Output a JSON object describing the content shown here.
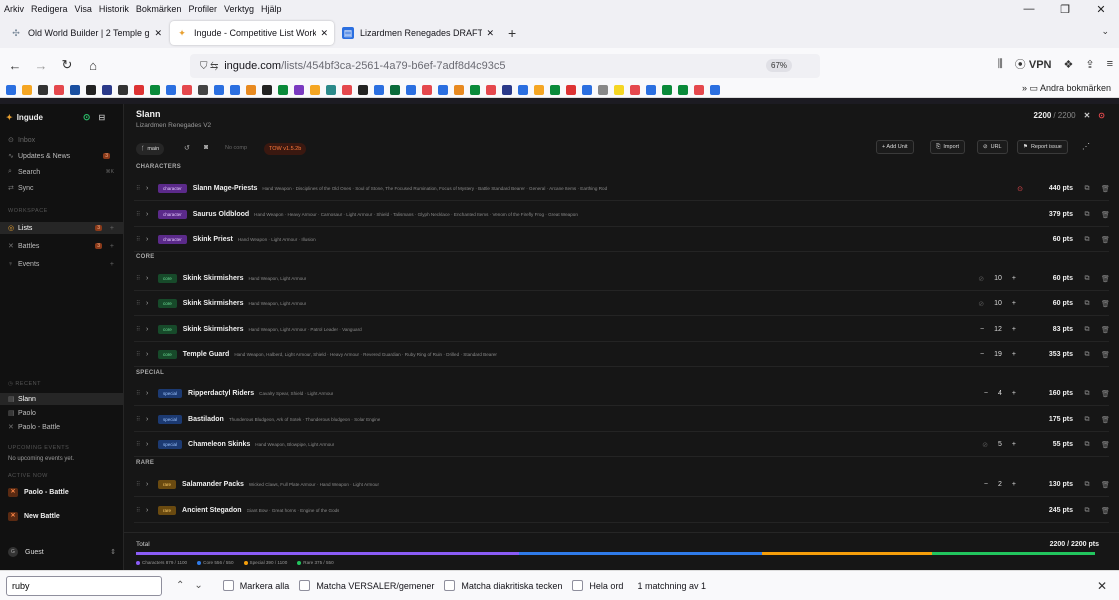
{
  "menu": [
    "Arkiv",
    "Redigera",
    "Visa",
    "Historik",
    "Bokmärken",
    "Profiler",
    "Verktyg",
    "Hjälp"
  ],
  "tabs": [
    {
      "title": "Old World Builder | 2 Temple gu",
      "icon": "puzzle-icon",
      "color": "#7a8a9a"
    },
    {
      "title": "Ingude - Competitive List Work",
      "icon": "bird-icon",
      "color": "#e8a030"
    },
    {
      "title": "Lizardmen Renegades DRAFT V",
      "icon": "doc-icon",
      "color": "#2b6fe0"
    }
  ],
  "url": {
    "host": "ingude.com",
    "path": "/lists/454bf3ca-2561-4a79-b6ef-7adf8d4c93c5"
  },
  "zoom": "67%",
  "vpn": "VPN",
  "bookmarks_other": "Andra bokmärken",
  "sidebar": {
    "brand": "Ingude",
    "inbox": "Inbox",
    "updates": "Updates & News",
    "updates_badge": "3",
    "search": "Search",
    "search_shortcut": "⌘K",
    "sync": "Sync",
    "workspace": "WORKSPACE",
    "lists": "Lists",
    "lists_badge": "3",
    "battles": "Battles",
    "battles_badge": "3",
    "events": "Events",
    "recent": "RECENT",
    "recent_items": [
      "Slann",
      "Paolo",
      "Paolo - Battle"
    ],
    "upcoming": "UPCOMING EVENTS",
    "no_upcoming": "No upcoming events yet.",
    "active": "ACTIVE NOW",
    "active_items": [
      "Paolo - Battle",
      "New Battle"
    ],
    "guest": "Guest",
    "guest_initial": "G"
  },
  "list": {
    "title": "Slann",
    "subtitle": "Lizardmen Renegades V2",
    "points": "2200",
    "max": "/ 2200"
  },
  "toolbar": {
    "branch": "main",
    "comp": "No comp",
    "version": "TOW v1.5.2b",
    "add_unit": "+ Add Unit",
    "import": "Import",
    "url": "URL",
    "report": "Report issue"
  },
  "sections": {
    "characters": "CHARACTERS",
    "core": "CORE",
    "special": "SPECIAL",
    "rare": "RARE"
  },
  "units": [
    {
      "tag": "character",
      "name": "Slann Mage-Priests",
      "equip": "Hand Weapon · Disciplines of the Old Ones · Soul of Stone, The Focused Rumination, Focus of Mystery · Battle Standard Bearer · General · Arcane Items · Earthing Rod",
      "qty": "",
      "pts": "440 pts",
      "alert": true
    },
    {
      "tag": "character",
      "name": "Saurus Oldblood",
      "equip": "Hand Weapon · Heavy Armour · Carnosaur · Light Armour · Shield · Talismans · Glyph Necklace · Enchanted Items · Venom of the Firefly Frog · Great Weapon",
      "qty": "",
      "pts": "379 pts"
    },
    {
      "tag": "character",
      "name": "Skink Priest",
      "equip": "Hand Weapon · Light Armour · Illusion",
      "qty": "",
      "pts": "60 pts"
    },
    {
      "tag": "core",
      "name": "Skink Skirmishers",
      "equip": "Hand Weapon, Light Armour",
      "qty": "10",
      "pts": "60 pts",
      "dimminus": true
    },
    {
      "tag": "core",
      "name": "Skink Skirmishers",
      "equip": "Hand Weapon, Light Armour",
      "qty": "10",
      "pts": "60 pts",
      "dimminus": true
    },
    {
      "tag": "core",
      "name": "Skink Skirmishers",
      "equip": "Hand Weapon, Light Armour · Patrol Leader · Vanguard",
      "qty": "12",
      "pts": "83 pts"
    },
    {
      "tag": "core",
      "name": "Temple Guard",
      "equip": "Hand Weapon, Halberd, Light Armour, Shield · Heavy Armour · Revered Guardian · Ruby Ring of Ruin · Drilled · Standard Bearer",
      "qty": "19",
      "pts": "353 pts"
    },
    {
      "tag": "special",
      "name": "Ripperdactyl Riders",
      "equip": "Cavalry Spear, Shield · Light Armour",
      "qty": "4",
      "pts": "160 pts"
    },
    {
      "tag": "special",
      "name": "Bastiladon",
      "equip": "Thunderous Bludgeon, Ark of Sotek · Thunderous bludgeon · Solar Engine",
      "qty": "",
      "pts": "175 pts"
    },
    {
      "tag": "special",
      "name": "Chameleon Skinks",
      "equip": "Hand Weapon, Blowpipe, Light Armour",
      "qty": "5",
      "pts": "55 pts",
      "dimminus": true
    },
    {
      "tag": "rare",
      "name": "Salamander Packs",
      "equip": "Wicked Claws, Full Plate Armour · Hand Weapon · Light Armour",
      "qty": "2",
      "pts": "130 pts"
    },
    {
      "tag": "rare",
      "name": "Ancient Stegadon",
      "equip": "Giant Bow · Great horns · Engine of the Gods",
      "qty": "",
      "pts": "245 pts"
    }
  ],
  "totals": {
    "label": "Total",
    "value": "2200 / 2200 pts",
    "breakdown": [
      {
        "label": "Characters 879 / 1100",
        "color": "#8b5cf6",
        "share": 879
      },
      {
        "label": "Core 556 / 550",
        "color": "#2f7be8",
        "share": 556
      },
      {
        "label": "Special 390 / 1100",
        "color": "#f59e0b",
        "share": 390
      },
      {
        "label": "Rare 375 / 550",
        "color": "#22c55e",
        "share": 375
      }
    ]
  },
  "find": {
    "query": "ruby",
    "highlight_all": "Markera alla",
    "match_case": "Matcha VERSALER/gemener",
    "diacritics": "Matcha diakritiska tecken",
    "whole_words": "Hela ord",
    "result": "1 matchning av 1"
  }
}
